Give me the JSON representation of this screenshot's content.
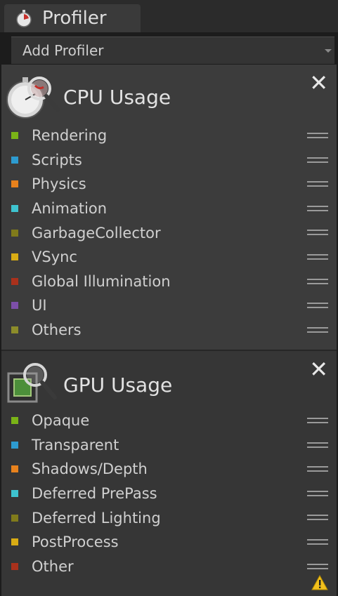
{
  "window": {
    "tab_title": "Profiler",
    "tab_icon": "profiler-icon"
  },
  "toolbar": {
    "add_profiler_label": "Add Profiler",
    "dropdown_icon": "chevron-down-icon"
  },
  "cpu": {
    "title": "CPU Usage",
    "icon": "stopwatch-magnifier-icon",
    "close_icon": "close-icon",
    "items": [
      {
        "label": "Rendering",
        "color": "#7ab317"
      },
      {
        "label": "Scripts",
        "color": "#2d9bd0"
      },
      {
        "label": "Physics",
        "color": "#e8821d"
      },
      {
        "label": "Animation",
        "color": "#3ec3cf"
      },
      {
        "label": "GarbageCollector",
        "color": "#807b1b"
      },
      {
        "label": "VSync",
        "color": "#d9ac14"
      },
      {
        "label": "Global Illumination",
        "color": "#a9311c"
      },
      {
        "label": "UI",
        "color": "#7d4fa8"
      },
      {
        "label": "Others",
        "color": "#8c8c2a"
      }
    ]
  },
  "gpu": {
    "title": "GPU Usage",
    "icon": "gpu-chip-magnifier-icon",
    "close_icon": "close-icon",
    "items": [
      {
        "label": "Opaque",
        "color": "#7ab317"
      },
      {
        "label": "Transparent",
        "color": "#2d9bd0"
      },
      {
        "label": "Shadows/Depth",
        "color": "#e8821d"
      },
      {
        "label": "Deferred PrePass",
        "color": "#3ec3cf"
      },
      {
        "label": "Deferred Lighting",
        "color": "#807b1b"
      },
      {
        "label": "PostProcess",
        "color": "#d9ac14"
      },
      {
        "label": "Other",
        "color": "#a9311c"
      }
    ],
    "warning_icon": "warning-icon"
  }
}
